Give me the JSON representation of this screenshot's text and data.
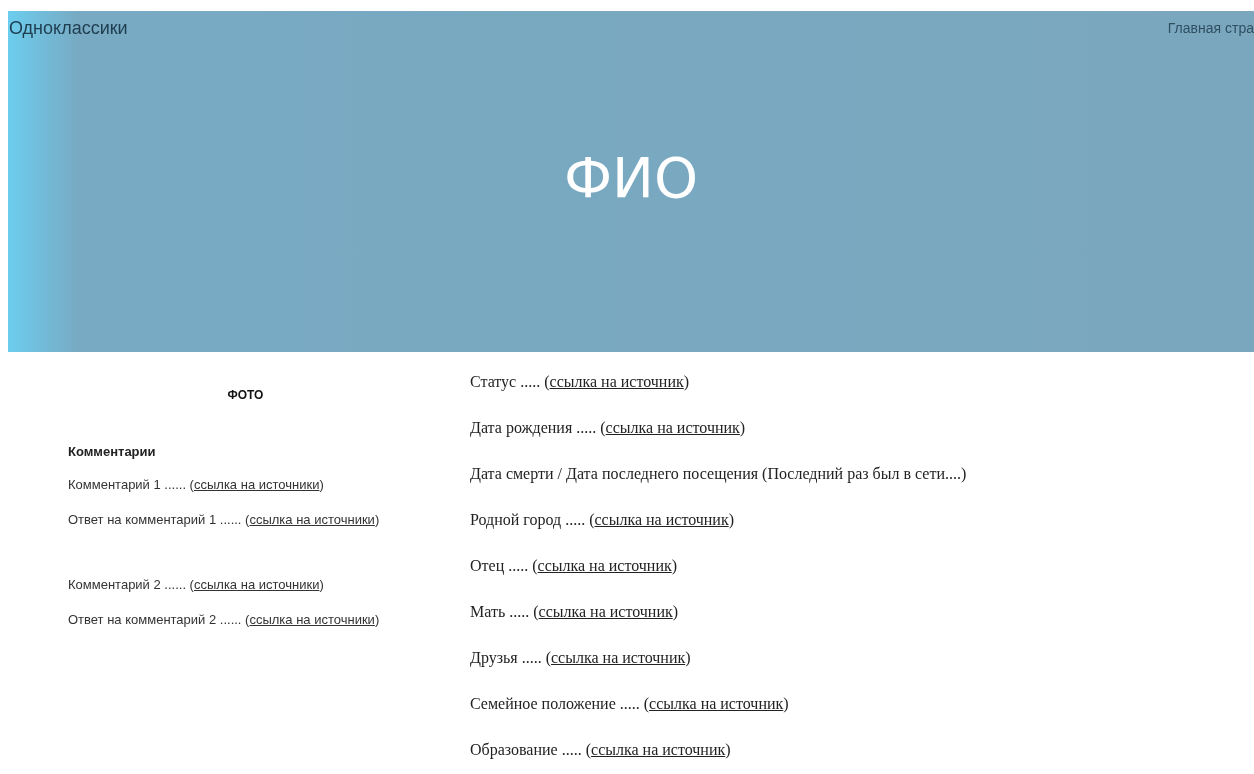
{
  "header": {
    "site_title": "Одноклассики",
    "nav_link": "Главная стра",
    "name": "ФИО"
  },
  "photo": {
    "label": "ФОТО"
  },
  "comments": {
    "title": "Комментарии",
    "groups": [
      {
        "items": [
          {
            "before": "Комментарий 1 ...... (",
            "link": "ссылка на источники",
            "after": ")"
          },
          {
            "before": "Ответ на комментарий 1 ...... (",
            "link": "ссылка на источники",
            "after": ")"
          }
        ]
      },
      {
        "items": [
          {
            "before": "Комментарий 2 ...... (",
            "link": "ссылка на источники",
            "after": ")"
          },
          {
            "before": "Ответ на комментарий 2 ...... (",
            "link": "ссылка на источники",
            "after": ")"
          }
        ]
      }
    ]
  },
  "info": [
    {
      "before": "Статус ..... (",
      "link": "ссылка на источник",
      "after": ")"
    },
    {
      "before": "Дата рождения ..... (",
      "link": "ссылка на источник",
      "after": ")"
    },
    {
      "before": "Дата смерти / Дата последнего посещения (Последний раз был в сети....)"
    },
    {
      "before": "Родной город ..... (",
      "link": "ссылка на источник",
      "after": ")"
    },
    {
      "before": "Отец ..... (",
      "link": "ссылка на источник",
      "after": ")"
    },
    {
      "before": "Мать ..... (",
      "link": "ссылка на источник",
      "after": ")"
    },
    {
      "before": "Друзья ..... (",
      "link": "ссылка на источник",
      "after": ")"
    },
    {
      "before": "Семейное положение ..... (",
      "link": "ссылка на источник",
      "after": ")"
    },
    {
      "before": "Образование ..... (",
      "link": "ссылка на источник",
      "after": ")"
    }
  ]
}
